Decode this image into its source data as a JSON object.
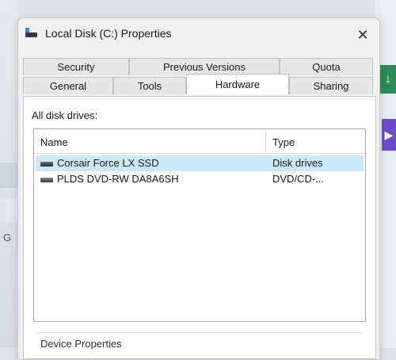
{
  "window": {
    "title": "Local Disk (C:) Properties",
    "close_glyph": "✕"
  },
  "tabs_top_row": [
    {
      "label": "Security"
    },
    {
      "label": "Previous Versions"
    },
    {
      "label": "Quota"
    }
  ],
  "tabs_bottom_row": [
    {
      "label": "General"
    },
    {
      "label": "Tools"
    },
    {
      "label": "Hardware",
      "active": true
    },
    {
      "label": "Sharing"
    }
  ],
  "hardware": {
    "list_label": "All disk drives:",
    "columns": {
      "name": "Name",
      "type": "Type"
    },
    "devices": [
      {
        "name": "Corsair Force LX SSD",
        "type": "Disk drives",
        "selected": true,
        "icon": "disk-drive-icon"
      },
      {
        "name": "PLDS DVD-RW DA8A6SH",
        "type": "DVD/CD-...",
        "selected": false,
        "icon": "dvd-drive-icon"
      }
    ],
    "group_label": "Device Properties"
  },
  "colors": {
    "selection": "#cde8f7",
    "dialog_bg": "#f0f0f0",
    "panel_bg": "#ffffff"
  }
}
